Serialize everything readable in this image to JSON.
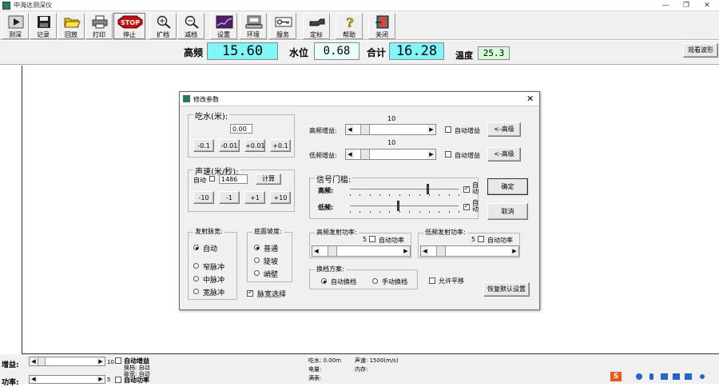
{
  "window": {
    "title": "中海达测深仪"
  },
  "toolbar": [
    {
      "label": "测深",
      "icon": "play-icon"
    },
    {
      "label": "记录",
      "icon": "floppy-disk-icon"
    },
    {
      "label": "回放",
      "icon": "folder-open-icon"
    },
    {
      "label": "打印",
      "icon": "printer-icon"
    },
    {
      "label": "停止",
      "icon": "stop-sign-icon"
    },
    {
      "label": "扩档",
      "icon": "zoom-in-icon"
    },
    {
      "label": "减档",
      "icon": "zoom-out-icon"
    },
    {
      "label": "设置",
      "icon": "settings-waveform-icon"
    },
    {
      "label": "环境",
      "icon": "computer-icon"
    },
    {
      "label": "服务",
      "icon": "key-icon"
    },
    {
      "label": "定标",
      "icon": "hand-pointer-icon"
    },
    {
      "label": "帮助",
      "icon": "question-icon"
    },
    {
      "label": "关闭",
      "icon": "exit-door-icon"
    }
  ],
  "readout": {
    "high_freq_label": "高频",
    "high_freq_value": "15.60",
    "water_level_label": "水位",
    "water_level_value": "0.68",
    "total_label": "合计",
    "total_value": "16.28",
    "temperature_label": "温度",
    "temperature_value": "25.3",
    "view_waveform_button": "观看波形"
  },
  "colors": {
    "readout_cyan": "#7ff7f7",
    "readout_lightcyan": "#e8ffff",
    "temperature_green": "#d8fcd8"
  },
  "dialog": {
    "title": "修改参数",
    "draft": {
      "title": "吃水(米):",
      "value": "0.00",
      "buttons": [
        "-0.1",
        "-0.01",
        "+0.01",
        "+0.1"
      ]
    },
    "sound_speed": {
      "title": "声速(米/秒):",
      "auto_label": "自动",
      "value": "1486",
      "calc_button": "计算",
      "buttons": [
        "-10",
        "-1",
        "+1",
        "+10"
      ]
    },
    "high_gain": {
      "label": "高频增益:",
      "value": "10",
      "auto_label": "自动增益",
      "advanced_button": "<-高级",
      "level": 0.1
    },
    "low_gain": {
      "label": "低频增益:",
      "value": "10",
      "auto_label": "自动增益",
      "advanced_button": "<-高级",
      "level": 0.1
    },
    "threshold": {
      "title": "信号门槛:",
      "high_label": "高频:",
      "high_level": 0.73,
      "high_auto": "自动",
      "low_label": "低频:",
      "low_level": 0.45,
      "low_auto": "自动"
    },
    "ok_button": "确定",
    "cancel_button": "取消",
    "high_power": {
      "title": "高频发射功率:",
      "value": "5",
      "auto_label": "自动功率",
      "level": 0.1
    },
    "low_power": {
      "title": "低频发射功率:",
      "value": "5",
      "auto_label": "自动功率",
      "level": 0.1
    },
    "pulse_width": {
      "title": "发射脉宽:",
      "options": [
        "自动",
        "窄脉冲",
        "中脉冲",
        "宽脉冲"
      ],
      "selected": "自动"
    },
    "bottom_slope": {
      "title": "底面坡度:",
      "options": [
        "普通",
        "陡坡",
        "峭壁"
      ],
      "selected": "普通"
    },
    "pulse_select": {
      "label": "脉宽选择",
      "checked": true
    },
    "range_switch": {
      "title": "换档方案:",
      "options": [
        "自动换档",
        "手动换档"
      ],
      "selected": "自动换档"
    },
    "allow_shift_label": "允许平移",
    "restore_defaults_button": "恢复默认设置"
  },
  "status": {
    "gain_label": "增益:",
    "power_label": "功率:",
    "gain_value": "10",
    "power_value": "5",
    "auto_gain_label": "自动增益",
    "auto_power_label": "自动功率",
    "range_text": "换档: 自动",
    "pulse_text": "脉宽: 自动",
    "draft_text": "吃水: 0.00m",
    "sound_text": "声速: 1500(m/s)",
    "battery_text": "电量:",
    "memory_text": "内存:",
    "full_text": "满表:"
  }
}
